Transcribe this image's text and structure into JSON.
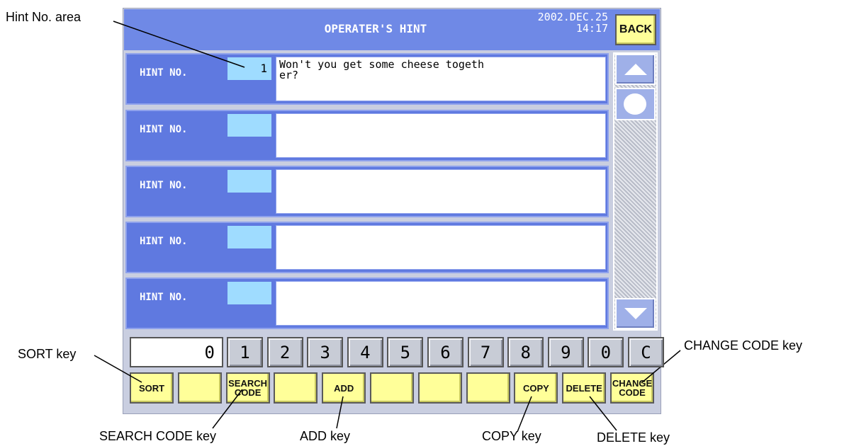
{
  "screen": {
    "title": "OPERATER'S HINT",
    "date": "2002.DEC.25",
    "time": "14:17",
    "back_label": "BACK"
  },
  "hints": [
    {
      "label": "HINT NO.",
      "number": "1",
      "text": "Won't you get some cheese togeth\ner?"
    },
    {
      "label": "HINT NO.",
      "number": "",
      "text": ""
    },
    {
      "label": "HINT NO.",
      "number": "",
      "text": ""
    },
    {
      "label": "HINT NO.",
      "number": "",
      "text": ""
    },
    {
      "label": "HINT NO.",
      "number": "",
      "text": ""
    }
  ],
  "scrollbar": {
    "up_icon": "triangle-up-icon",
    "thumb_icon": "circle-icon",
    "down_icon": "triangle-down-icon"
  },
  "keypad": {
    "display_value": "0",
    "keys": [
      "1",
      "2",
      "3",
      "4",
      "5",
      "6",
      "7",
      "8",
      "9",
      "0",
      "C"
    ]
  },
  "function_keys": {
    "sort": "SORT",
    "blank1": "",
    "search_code": "SEARCH\nCODE",
    "blank2": "",
    "add": "ADD",
    "blank3": "",
    "blank4": "",
    "blank5": "",
    "copy": "COPY",
    "delete": "DELETE",
    "change_code": "CHANGE\nCODE"
  },
  "annotations": {
    "hint_no_area": "Hint No. area",
    "sort_key": "SORT key",
    "change_code_key": "CHANGE CODE key",
    "search_code_key": "SEARCH CODE key",
    "add_key": "ADD key",
    "copy_key": "COPY key",
    "delete_key": "DELETE key"
  },
  "colors": {
    "title_bar": "#6f89e6",
    "hint_row": "#5f79e0",
    "hint_number_field": "#9fdcff",
    "function_key": "#ffff99",
    "device_bg": "#c9cee0"
  }
}
